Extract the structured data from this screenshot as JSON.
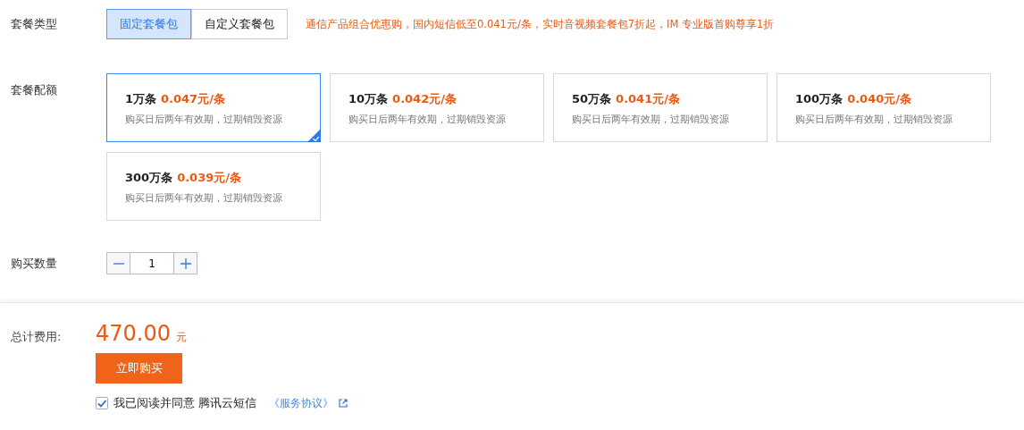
{
  "package_type": {
    "label": "套餐类型",
    "options": [
      {
        "label": "固定套餐包",
        "selected": true
      },
      {
        "label": "自定义套餐包",
        "selected": false
      }
    ],
    "promo": "通信产品组合优惠购，国内短信低至0.041元/条，实时音视频套餐包7折起，IM 专业版首购尊享1折"
  },
  "quota": {
    "label": "套餐配额",
    "cards": [
      {
        "amount": "1万条",
        "price": "0.047元/条",
        "note": "购买日后两年有效期，过期销毁资源",
        "selected": true
      },
      {
        "amount": "10万条",
        "price": "0.042元/条",
        "note": "购买日后两年有效期，过期销毁资源",
        "selected": false
      },
      {
        "amount": "50万条",
        "price": "0.041元/条",
        "note": "购买日后两年有效期，过期销毁资源",
        "selected": false
      },
      {
        "amount": "100万条",
        "price": "0.040元/条",
        "note": "购买日后两年有效期，过期销毁资源",
        "selected": false
      },
      {
        "amount": "300万条",
        "price": "0.039元/条",
        "note": "购买日后两年有效期，过期销毁资源",
        "selected": false
      }
    ]
  },
  "quantity": {
    "label": "购买数量",
    "value": "1"
  },
  "footer": {
    "total_label": "总计费用:",
    "total": "470.00",
    "unit": "元",
    "buy_button": "立即购买",
    "agreement": {
      "checked": true,
      "text": "我已阅读并同意 腾讯云短信",
      "link": "《服务协议》"
    }
  }
}
